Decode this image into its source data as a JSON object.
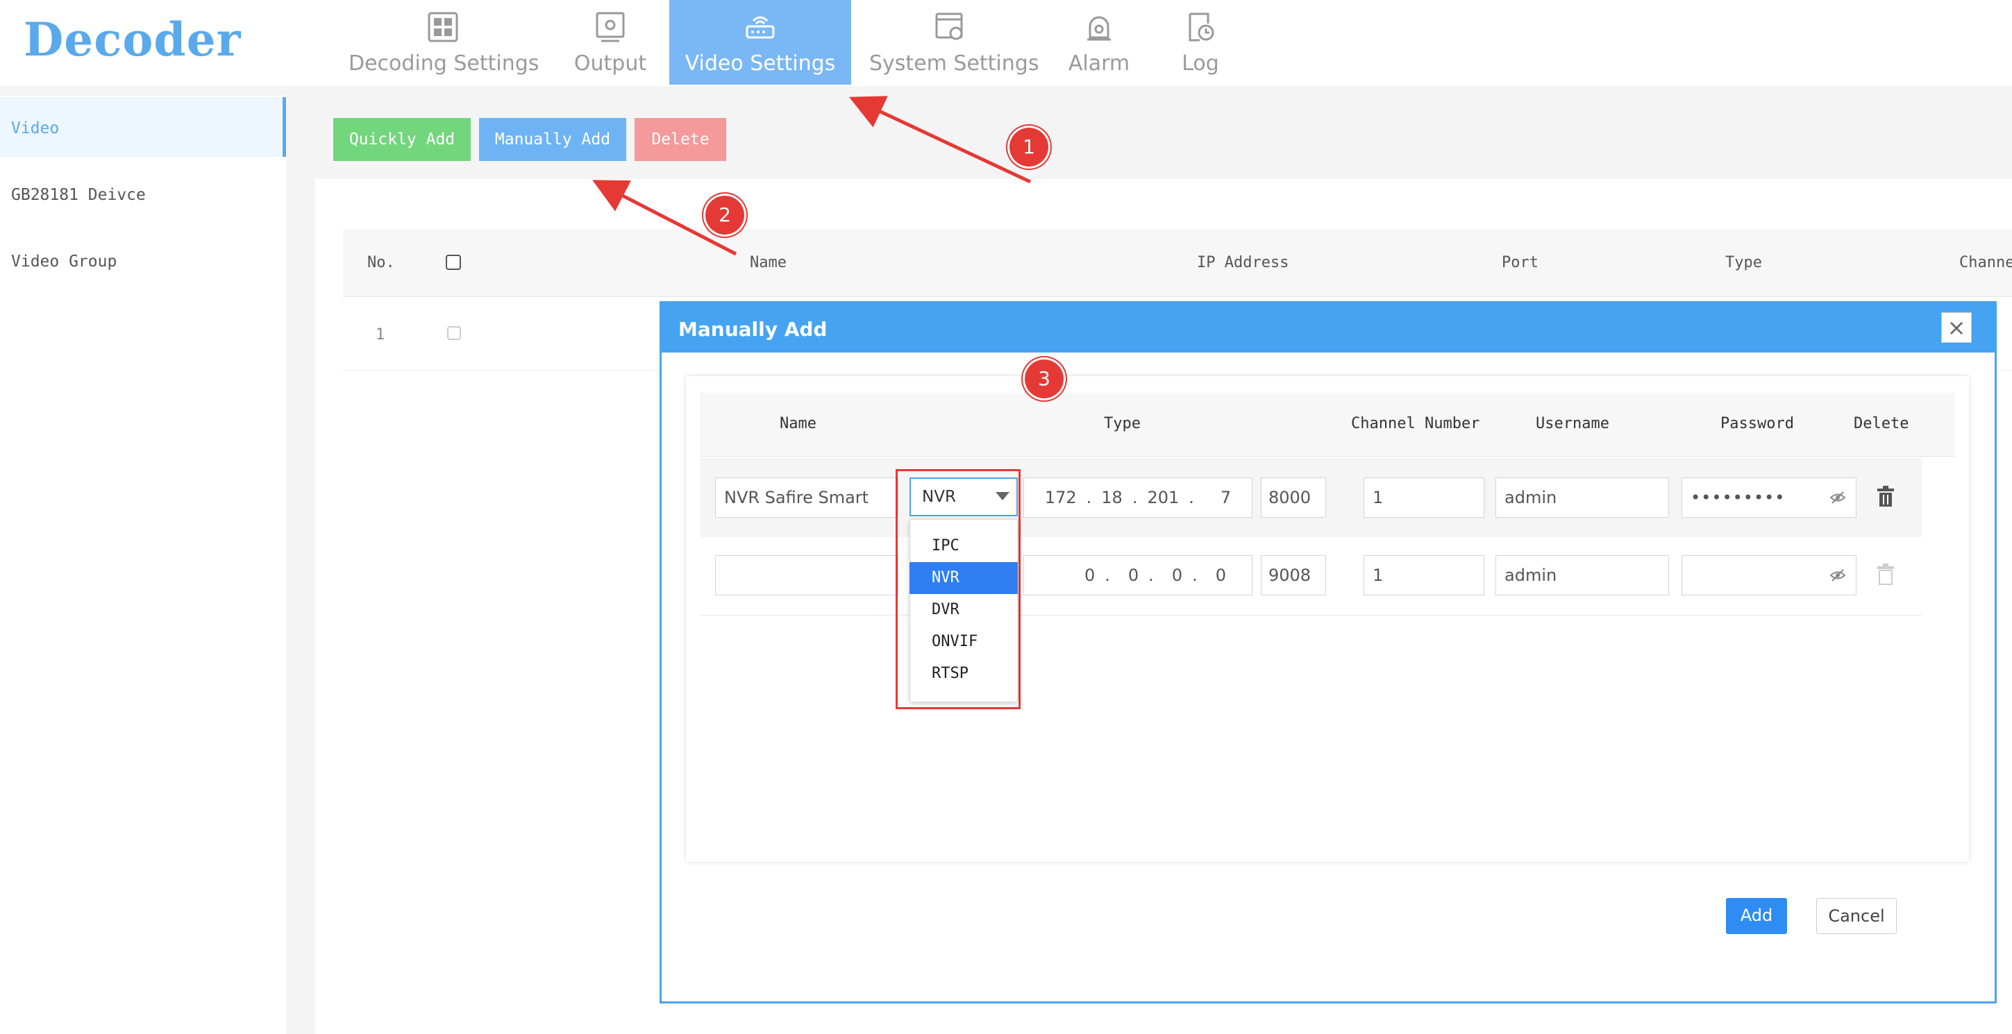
{
  "header": {
    "logo": "Decoder",
    "tabs": [
      {
        "label": "Decoding Settings",
        "icon": "grid-icon"
      },
      {
        "label": "Output",
        "icon": "monitor-gear-icon"
      },
      {
        "label": "Video Settings",
        "icon": "router-icon",
        "active": true
      },
      {
        "label": "System Settings",
        "icon": "settings-window-icon"
      },
      {
        "label": "Alarm",
        "icon": "alarm-light-icon"
      },
      {
        "label": "Log",
        "icon": "log-clock-icon"
      }
    ]
  },
  "sidebar": {
    "items": [
      {
        "label": "Video",
        "active": true
      },
      {
        "label": "GB28181 Deivce"
      },
      {
        "label": "Video Group"
      }
    ]
  },
  "toolbar": {
    "quick_add": "Quickly Add",
    "manual_add": "Manually Add",
    "delete": "Delete"
  },
  "table": {
    "headers": [
      "No.",
      "Name",
      "IP Address",
      "Port",
      "Type",
      "Channe"
    ],
    "rows": [
      {
        "no": "1"
      }
    ]
  },
  "annotations": {
    "badges": [
      "1",
      "2",
      "3"
    ]
  },
  "modal": {
    "title": "Manually Add",
    "headers": {
      "name": "Name",
      "type": "Type",
      "channel": "Channel Number",
      "username": "Username",
      "password": "Password",
      "delete": "Delete"
    },
    "rows": [
      {
        "name": "NVR Safire Smart",
        "type": "NVR",
        "ip": [
          "172",
          "18",
          "201",
          "7"
        ],
        "port": "8000",
        "channel": "1",
        "username": "admin",
        "password": "•••••••••"
      },
      {
        "name": "",
        "type": "",
        "ip": [
          "0",
          "0",
          "0",
          "0"
        ],
        "port": "9008",
        "channel": "1",
        "username": "admin",
        "password": ""
      }
    ],
    "type_options": [
      "IPC",
      "NVR",
      "DVR",
      "ONVIF",
      "RTSP"
    ],
    "selected_option": "NVR",
    "add_label": "Add",
    "cancel_label": "Cancel"
  },
  "colors": {
    "accent": "#46a3f1",
    "quick_add": "#72d67c",
    "manual_add": "#6eb4f5",
    "delete": "#f59a9a",
    "annotation": "#e53935",
    "option_selected": "#2f7ef2"
  }
}
